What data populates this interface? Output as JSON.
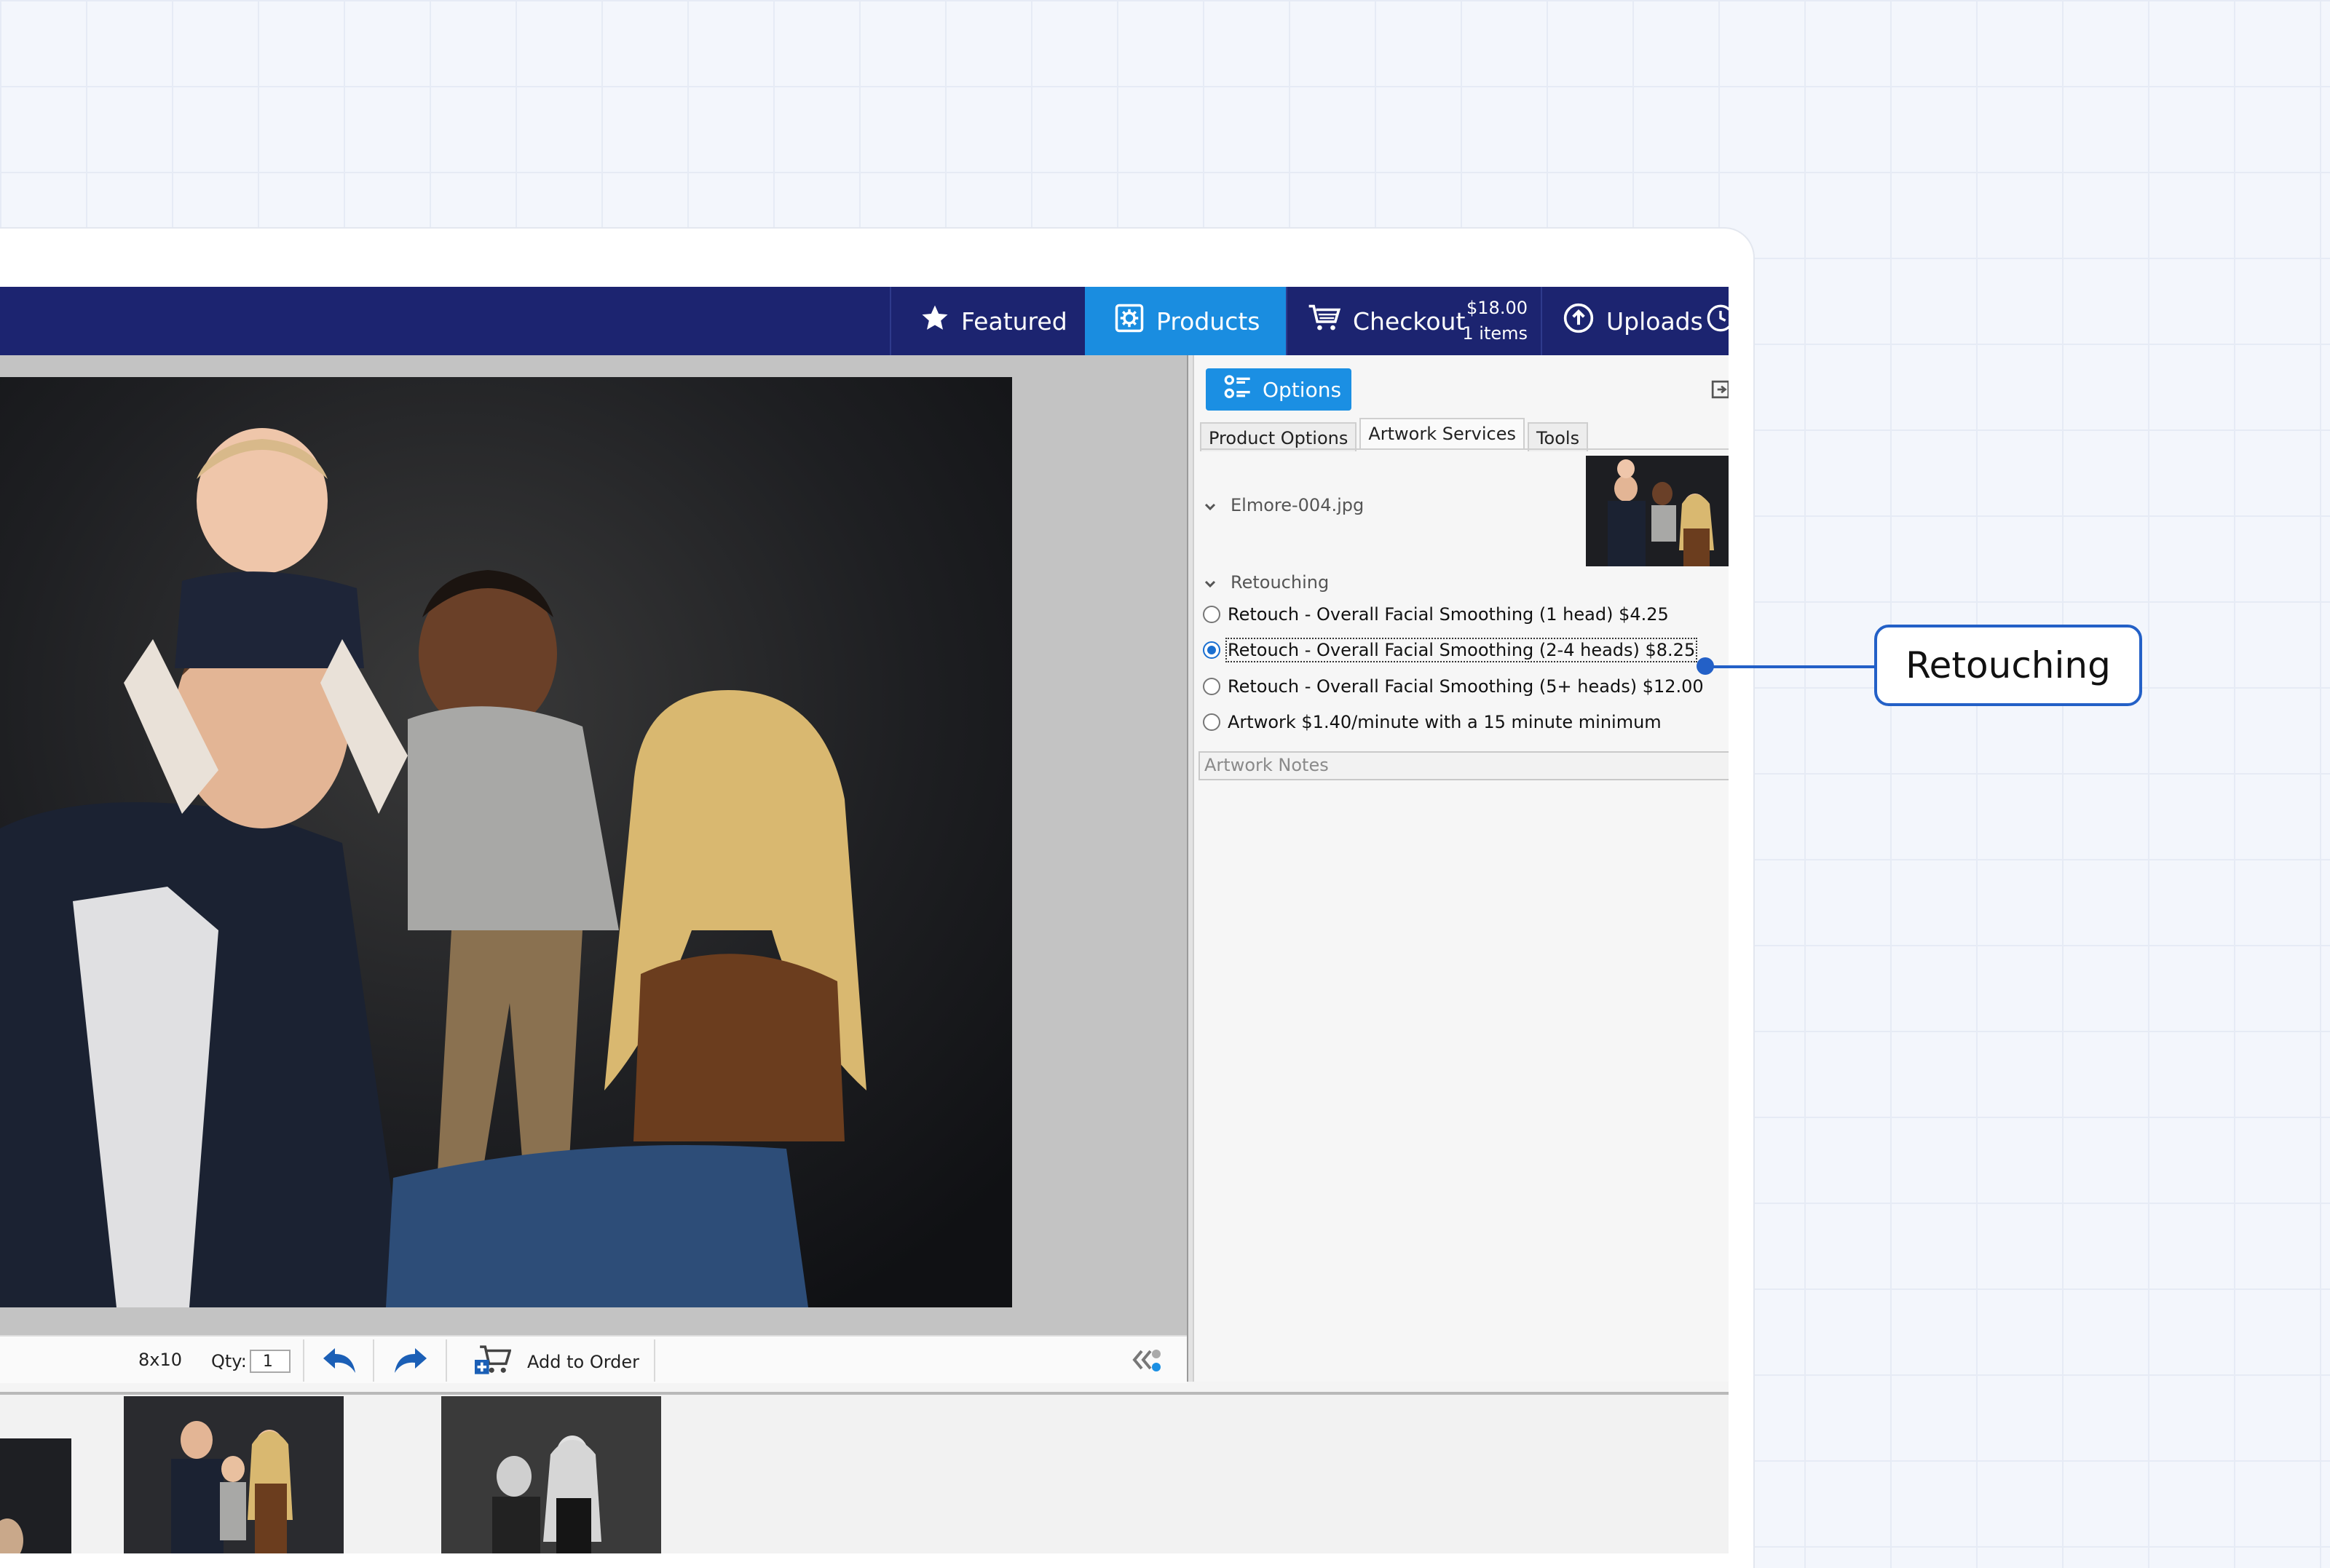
{
  "nav": {
    "featured": "Featured",
    "products": "Products",
    "checkout": "Checkout",
    "checkout_total": "$18.00",
    "checkout_items": "1 items",
    "uploads": "Uploads"
  },
  "panel": {
    "options_label": "Options",
    "tabs": [
      "Product Options",
      "Artwork Services",
      "Tools"
    ],
    "active_tab": "Artwork Services",
    "file_name": "Elmore-004.jpg",
    "section": "Retouching",
    "options": [
      {
        "label": "Retouch - Overall Facial Smoothing (1 head) $4.25",
        "selected": false
      },
      {
        "label": "Retouch - Overall Facial Smoothing (2-4 heads) $8.25",
        "selected": true
      },
      {
        "label": "Retouch - Overall Facial Smoothing (5+ heads) $12.00",
        "selected": false
      },
      {
        "label": "Artwork $1.40/minute with a 15 minute minimum",
        "selected": false
      }
    ],
    "notes_placeholder": "Artwork Notes"
  },
  "toolbar": {
    "size": "8x10",
    "qty_label": "Qty:",
    "qty_value": "1",
    "add_to_order": "Add to Order"
  },
  "callout": {
    "label": "Retouching"
  },
  "colors": {
    "nav_bg": "#1c2470",
    "accent": "#1a8de0",
    "callout": "#2360c7"
  }
}
